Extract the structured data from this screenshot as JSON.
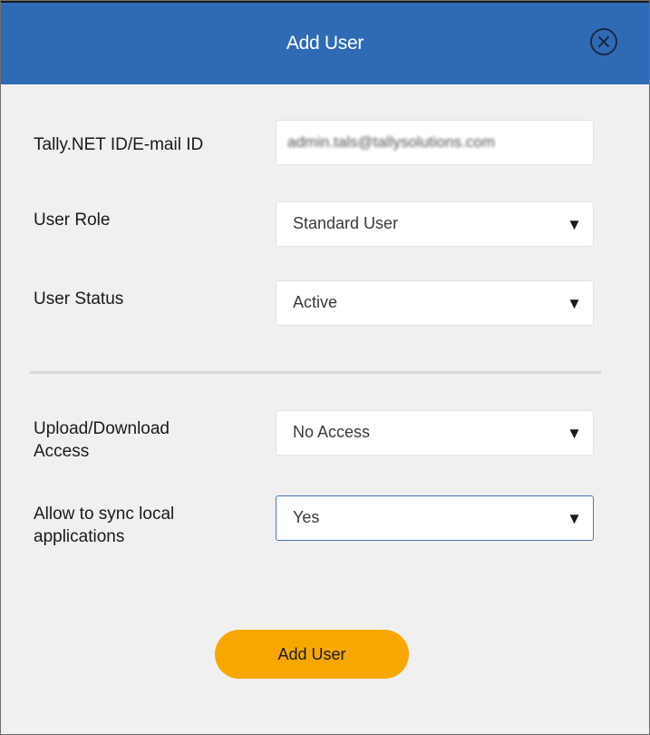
{
  "dialog": {
    "title": "Add User",
    "close_icon": "close-circle-icon"
  },
  "form": {
    "email": {
      "label": "Tally.NET ID/E-mail ID",
      "value": "admin.tals@tallysolutions.com"
    },
    "user_role": {
      "label": "User Role",
      "value": "Standard User"
    },
    "user_status": {
      "label": "User Status",
      "value": "Active"
    },
    "upload_download": {
      "label_line1": "Upload/Download",
      "label_line2": "Access",
      "value": "No Access"
    },
    "sync_local": {
      "label_line1": "Allow to sync local",
      "label_line2": "applications",
      "value": "Yes"
    }
  },
  "actions": {
    "add_user_label": "Add User"
  },
  "dropdown_caret": "▼",
  "colors": {
    "header": "#2f6bb5",
    "button": "#f7a800",
    "focus_border": "#4a78b8"
  }
}
